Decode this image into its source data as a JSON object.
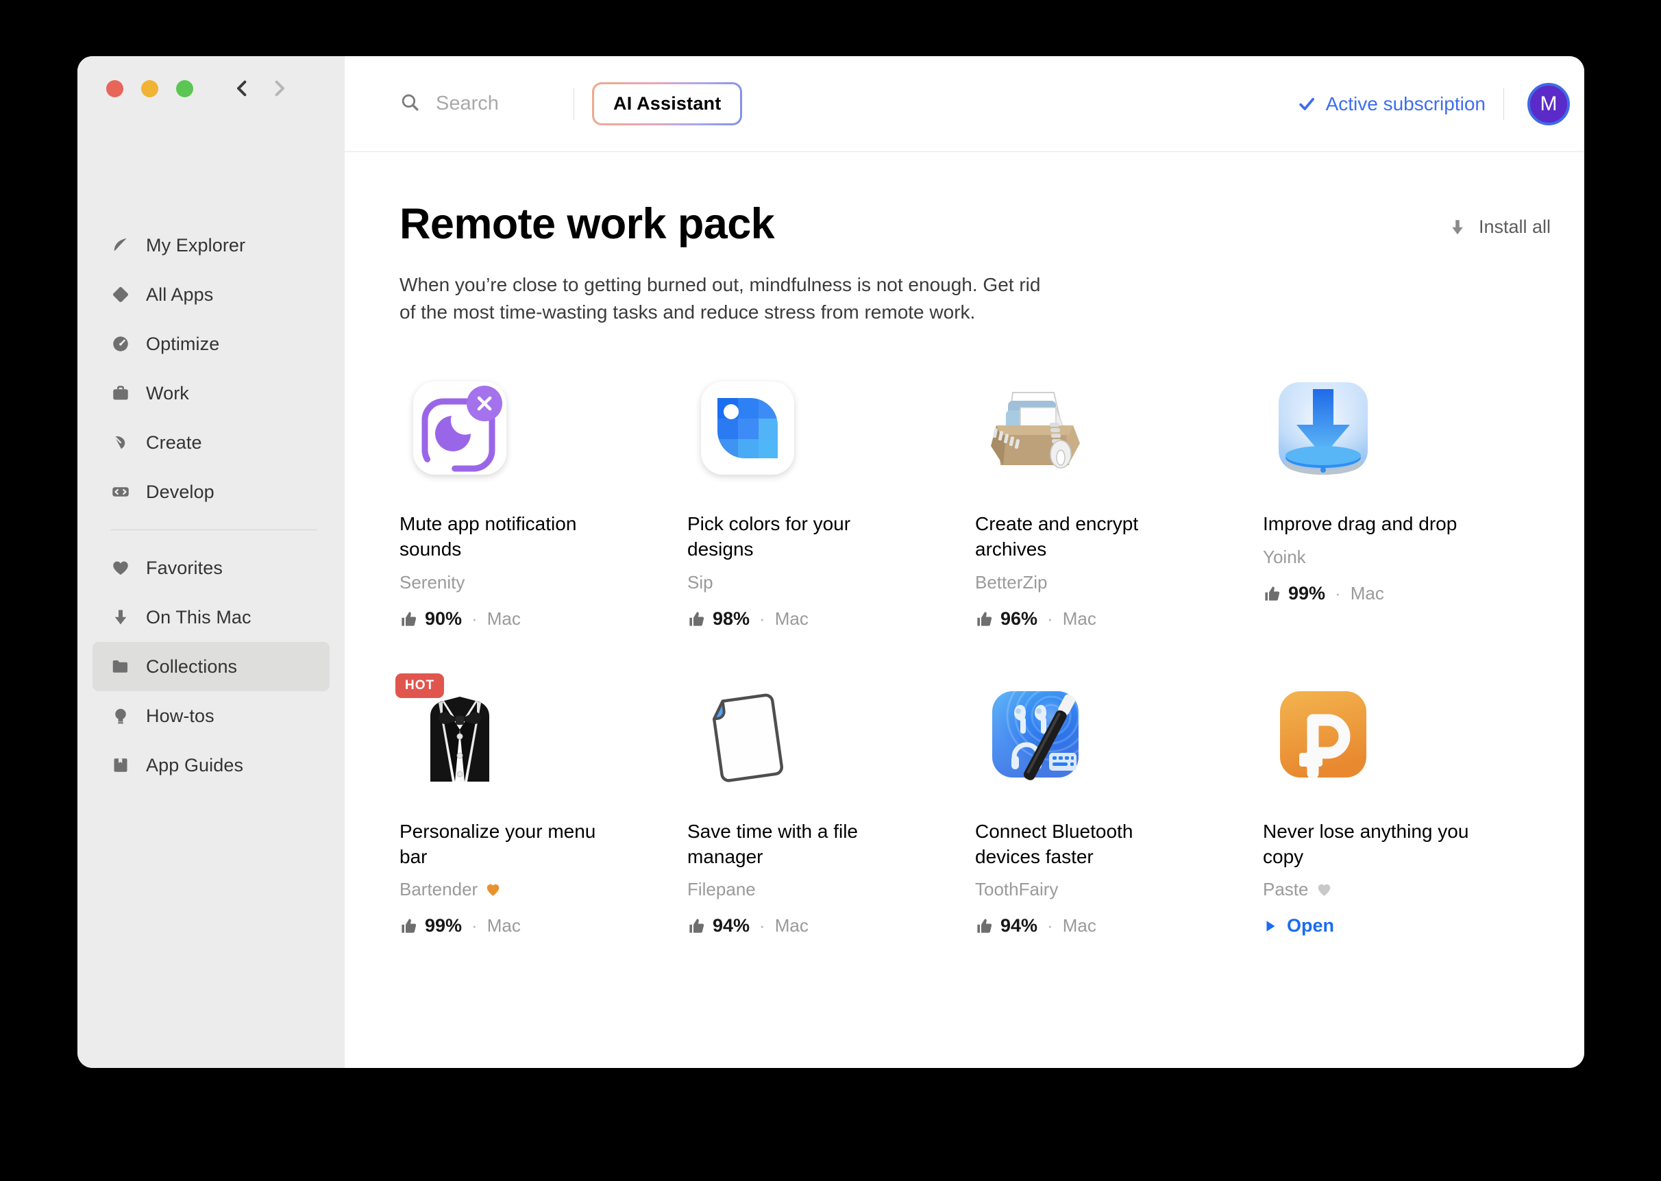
{
  "window": {
    "traffic_lights": [
      "close",
      "minimize",
      "zoom"
    ],
    "nav": {
      "back": "back-chevron",
      "forward": "forward-chevron"
    }
  },
  "sidebar": {
    "items": [
      {
        "label": "My Explorer",
        "icon": "leaf-icon",
        "active": false
      },
      {
        "label": "All Apps",
        "icon": "diamond-icon",
        "active": false
      },
      {
        "label": "Optimize",
        "icon": "gauge-icon",
        "active": false
      },
      {
        "label": "Work",
        "icon": "briefcase-icon",
        "active": false
      },
      {
        "label": "Create",
        "icon": "pen-nib-icon",
        "active": false
      },
      {
        "label": "Develop",
        "icon": "code-brackets-icon",
        "active": false
      }
    ],
    "items2": [
      {
        "label": "Favorites",
        "icon": "heart-icon",
        "active": false
      },
      {
        "label": "On This Mac",
        "icon": "download-arrow-icon",
        "active": false
      },
      {
        "label": "Collections",
        "icon": "folder-icon",
        "active": true
      },
      {
        "label": "How-tos",
        "icon": "lightbulb-icon",
        "active": false
      },
      {
        "label": "App Guides",
        "icon": "book-bookmark-icon",
        "active": false
      }
    ]
  },
  "topbar": {
    "search_placeholder": "Search",
    "search_value": "",
    "ai_assistant_label": "AI Assistant",
    "subscription_label": "Active subscription",
    "subscription_color": "#3d6df0",
    "avatar_initial": "M"
  },
  "main": {
    "title": "Remote work pack",
    "description": "When you’re close to getting burned out, mindfulness is not enough. Get rid of the most time-wasting tasks and reduce stress from remote work.",
    "install_all_label": "Install all"
  },
  "cards": [
    {
      "title": "Mute app notification sounds",
      "vendor": "Serenity",
      "vendor_heart": null,
      "rating": "90%",
      "separator": "·",
      "platform": "Mac",
      "icon": "serenity-icon",
      "badge": null,
      "action": null
    },
    {
      "title": "Pick colors for your designs",
      "vendor": "Sip",
      "vendor_heart": null,
      "rating": "98%",
      "separator": "·",
      "platform": "Mac",
      "icon": "sip-icon",
      "badge": null,
      "action": null
    },
    {
      "title": "Create and encrypt archives",
      "vendor": "BetterZip",
      "vendor_heart": null,
      "rating": "96%",
      "separator": "·",
      "platform": "Mac",
      "icon": "betterzip-icon",
      "badge": null,
      "action": null
    },
    {
      "title": "Improve drag and drop",
      "vendor": "Yoink",
      "vendor_heart": null,
      "rating": "99%",
      "separator": "·",
      "platform": "Mac",
      "icon": "yoink-icon",
      "badge": null,
      "action": null
    },
    {
      "title": "Personalize your menu bar",
      "vendor": "Bartender",
      "vendor_heart": "#e8922f",
      "rating": "99%",
      "separator": "·",
      "platform": "Mac",
      "icon": "bartender-icon",
      "badge": "HOT",
      "action": null
    },
    {
      "title": "Save time with a file manager",
      "vendor": "Filepane",
      "vendor_heart": null,
      "rating": "94%",
      "separator": "·",
      "platform": "Mac",
      "icon": "filepane-icon",
      "badge": null,
      "action": null
    },
    {
      "title": "Connect Bluetooth devices faster",
      "vendor": "ToothFairy",
      "vendor_heart": null,
      "rating": "94%",
      "separator": "·",
      "platform": "Mac",
      "icon": "toothfairy-icon",
      "badge": null,
      "action": null
    },
    {
      "title": "Never lose anything you copy",
      "vendor": "Paste",
      "vendor_heart": "#c9c9c9",
      "rating": null,
      "separator": null,
      "platform": null,
      "icon": "paste-icon",
      "badge": null,
      "action": "Open"
    }
  ]
}
